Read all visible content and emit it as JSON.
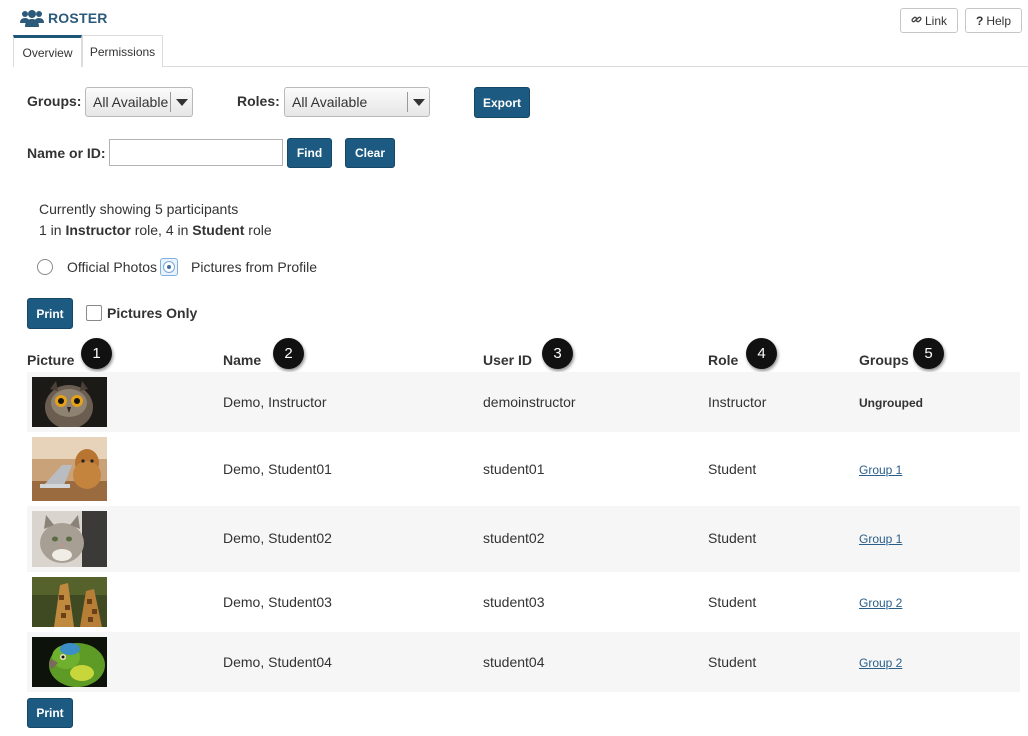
{
  "header": {
    "title": "ROSTER",
    "icon": "users-icon",
    "link_label": "Link",
    "help_label": "Help",
    "help_mark": "?"
  },
  "tabs": [
    {
      "label": "Overview",
      "active": true
    },
    {
      "label": "Permissions",
      "active": false
    }
  ],
  "filters": {
    "groups_label": "Groups:",
    "groups_value": "All Available",
    "roles_label": "Roles:",
    "roles_value": "All Available",
    "export_label": "Export",
    "name_label": "Name or ID:",
    "name_value": "",
    "find_label": "Find",
    "clear_label": "Clear"
  },
  "summary": {
    "line1": "Currently showing 5 participants",
    "line2_a": "1 in ",
    "line2_b": "Instructor",
    "line2_c": " role, 4 in ",
    "line2_d": "Student",
    "line2_e": " role"
  },
  "photo_options": {
    "official_label": "Official Photos",
    "profile_label": "Pictures from Profile",
    "selected": "profile"
  },
  "actions": {
    "print_label": "Print",
    "pictures_only_label": "Pictures Only",
    "pictures_only_checked": false
  },
  "table": {
    "columns": [
      {
        "label": "Picture",
        "badge": "1"
      },
      {
        "label": "Name",
        "badge": "2"
      },
      {
        "label": "User ID",
        "badge": "3"
      },
      {
        "label": "Role",
        "badge": "4"
      },
      {
        "label": "Groups",
        "badge": "5"
      }
    ],
    "rows": [
      {
        "picture": "owl",
        "name": "Demo, Instructor",
        "user_id": "demoinstructor",
        "role": "Instructor",
        "groups": "Ungrouped",
        "groups_is_link": false
      },
      {
        "picture": "dog-with-laptop",
        "name": "Demo, Student01",
        "user_id": "student01",
        "role": "Student",
        "groups": "Group 1",
        "groups_is_link": true
      },
      {
        "picture": "cat",
        "name": "Demo, Student02",
        "user_id": "student02",
        "role": "Student",
        "groups": "Group 1",
        "groups_is_link": true
      },
      {
        "picture": "giraffe",
        "name": "Demo, Student03",
        "user_id": "student03",
        "role": "Student",
        "groups": "Group 2",
        "groups_is_link": true
      },
      {
        "picture": "parrot",
        "name": "Demo, Student04",
        "user_id": "student04",
        "role": "Student",
        "groups": "Group 2",
        "groups_is_link": true
      }
    ]
  },
  "colors": {
    "primary_button": "#1c5a82",
    "title": "#2c5a7a",
    "link": "#2a5f8b",
    "row_shade": "#f6f6f6"
  }
}
